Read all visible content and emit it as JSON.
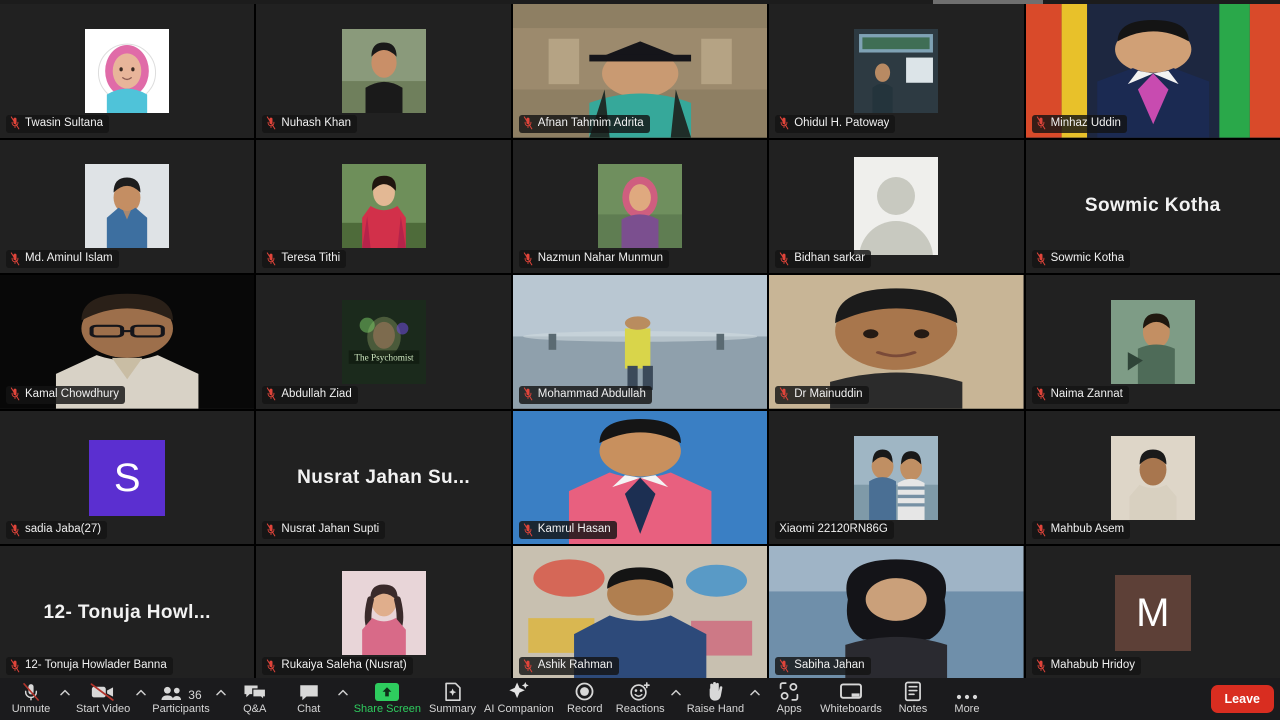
{
  "app": {
    "title": "Zoom Meeting — Gallery View"
  },
  "gallery": {
    "participants": [
      {
        "name": "Twasin Sultana",
        "muted": true,
        "tile_type": "avatar-photo",
        "avatar": {
          "kind": "photo",
          "bg": "#ffffff",
          "skin": "#e8b59a",
          "cloth": "#4fc3d9",
          "accent": "#e06ba8",
          "shape": "hijab"
        }
      },
      {
        "name": "Nuhash Khan",
        "muted": true,
        "tile_type": "avatar-photo",
        "avatar": {
          "kind": "photo",
          "bg": "#8a9a7b",
          "skin": "#c98f68",
          "cloth": "#1a1a1a",
          "accent": "#2b2b2b",
          "shape": "man-outdoor"
        }
      },
      {
        "name": "Afnan Tahmim Adrita",
        "muted": true,
        "tile_type": "video",
        "avatar": {
          "kind": "video",
          "bg": "#8e7f63",
          "skin": "#c99a72",
          "cloth": "#1f2d28",
          "accent": "#36a89a",
          "shape": "graduation"
        }
      },
      {
        "name": "Ohidul H. Patoway",
        "muted": true,
        "tile_type": "avatar-photo",
        "avatar": {
          "kind": "photo",
          "bg": "#2d3a42",
          "skin": "#b88a63",
          "cloth": "#24343c",
          "accent": "#9fb7c4",
          "shape": "indoor-sign"
        }
      },
      {
        "name": "Minhaz Uddin",
        "muted": true,
        "tile_type": "video",
        "avatar": {
          "kind": "video",
          "bg": "#1d2740",
          "skin": "#d0a076",
          "cloth": "#1b2a52",
          "accent": "#c84bb0",
          "shape": "man-suit-stripes"
        }
      },
      {
        "name": "Md. Aminul Islam",
        "muted": true,
        "tile_type": "avatar-photo",
        "avatar": {
          "kind": "photo",
          "bg": "#dfe3e6",
          "skin": "#c48e63",
          "cloth": "#3d6fa0",
          "accent": "#2a2a2a",
          "shape": "man-blue-shirt"
        }
      },
      {
        "name": "Teresa Tithi",
        "muted": true,
        "tile_type": "avatar-photo",
        "avatar": {
          "kind": "photo",
          "bg": "#6e8f5a",
          "skin": "#e3b894",
          "cloth": "#d2304a",
          "accent": "#b5234a",
          "shape": "woman-red"
        }
      },
      {
        "name": "Nazmun Nahar Munmun",
        "muted": true,
        "tile_type": "avatar-photo",
        "avatar": {
          "kind": "photo",
          "bg": "#6f8f5e",
          "skin": "#dfa97f",
          "cloth": "#cf5e7f",
          "accent": "#7b4f8f",
          "shape": "woman-hijab-outdoor"
        }
      },
      {
        "name": "Bidhan sarkar",
        "muted": true,
        "tile_type": "silhouette",
        "avatar": {
          "kind": "silhouette",
          "bg": "#efefec",
          "fg": "#c8c9c0"
        }
      },
      {
        "name": "Sowmic Kotha",
        "muted": true,
        "tile_type": "name-only",
        "display_name": "Sowmic Kotha"
      },
      {
        "name": "Kamal Chowdhury",
        "muted": true,
        "tile_type": "video",
        "avatar": {
          "kind": "video",
          "bg": "#080808",
          "skin": "#9d6f4b",
          "cloth": "#d8d2c6",
          "accent": "#c9bda4",
          "shape": "man-dark-bg"
        }
      },
      {
        "name": "Abdullah Ziad",
        "muted": true,
        "tile_type": "avatar-photo",
        "avatar": {
          "kind": "photo",
          "bg": "#1b2a1c",
          "skin": "#7d6b4e",
          "cloth": "#2a3a20",
          "accent": "#7fd46a",
          "shape": "psychomist-art"
        }
      },
      {
        "name": "Mohammad Abdullah",
        "muted": true,
        "tile_type": "video",
        "avatar": {
          "kind": "video",
          "bg": "#a9b8c4",
          "skin": "#b98c5f",
          "cloth": "#d9d54a",
          "accent": "#3b4a5a",
          "shape": "beach-walk"
        }
      },
      {
        "name": "Dr Mainuddin",
        "muted": true,
        "tile_type": "video",
        "avatar": {
          "kind": "video",
          "bg": "#c8b596",
          "skin": "#a8764c",
          "cloth": "#2b2b2b",
          "accent": "#6d4c2f",
          "shape": "man-portrait"
        }
      },
      {
        "name": "Naima Zannat",
        "muted": true,
        "tile_type": "avatar-photo",
        "avatar": {
          "kind": "photo",
          "bg": "#7e9c86",
          "skin": "#c38f63",
          "cloth": "#4e6b58",
          "accent": "#2f4438",
          "shape": "child-green"
        }
      },
      {
        "name": "sadia Jaba(27)",
        "muted": true,
        "tile_type": "letter",
        "avatar": {
          "kind": "letter",
          "letter": "S",
          "bg": "#5b2fd0",
          "fg": "#ffffff"
        }
      },
      {
        "name": "Nusrat Jahan Supti",
        "muted": true,
        "tile_type": "name-only",
        "display_name": "Nusrat Jahan Su..."
      },
      {
        "name": "Kamrul Hasan",
        "muted": true,
        "tile_type": "video",
        "avatar": {
          "kind": "video",
          "bg": "#3a7fc4",
          "skin": "#c8905e",
          "cloth": "#e8607f",
          "accent": "#1c2f52",
          "shape": "man-pink-shirt"
        }
      },
      {
        "name": "Xiaomi 22120RN86G",
        "muted": false,
        "tile_type": "avatar-photo",
        "avatar": {
          "kind": "photo",
          "bg": "#9fb6c4",
          "skin": "#c08f63",
          "cloth": "#4a6f94",
          "accent": "#e6e6e6",
          "shape": "two-men"
        }
      },
      {
        "name": "Mahbub Asem",
        "muted": true,
        "tile_type": "avatar-photo",
        "avatar": {
          "kind": "photo",
          "bg": "#ded6c8",
          "skin": "#a87murky",
          "cloth": "#d8d0c0",
          "accent": "#7a6a58",
          "shape": "man-beige"
        }
      },
      {
        "name": "12- Tonuja Howlader Banna",
        "muted": true,
        "tile_type": "name-only",
        "display_name": "12- Tonuja Howl..."
      },
      {
        "name": "Rukaiya Saleha (Nusrat)",
        "muted": true,
        "tile_type": "avatar-photo",
        "avatar": {
          "kind": "photo",
          "bg": "#e8d5d8",
          "skin": "#e0ae8c",
          "cloth": "#d86a88",
          "accent": "#3a2a2a",
          "shape": "woman-pink"
        }
      },
      {
        "name": "Ashik Rahman",
        "muted": true,
        "tile_type": "video",
        "avatar": {
          "kind": "video",
          "bg": "#c8c0b0",
          "skin": "#b07f50",
          "cloth": "#2d4a7a",
          "accent": "#d94a3a",
          "shape": "man-mural"
        }
      },
      {
        "name": "Sabiha Jahan",
        "muted": true,
        "tile_type": "video",
        "avatar": {
          "kind": "video",
          "bg": "#6f8faa",
          "skin": "#caa07a",
          "cloth": "#2a2a30",
          "accent": "#1a1a1e",
          "shape": "woman-outdoor"
        }
      },
      {
        "name": "Mahabub Hridoy",
        "muted": true,
        "tile_type": "letter",
        "avatar": {
          "kind": "letter",
          "letter": "M",
          "bg": "#5d4037",
          "fg": "#ffffff"
        }
      }
    ]
  },
  "toolbar": {
    "items": [
      {
        "id": "unmute",
        "label": "Unmute",
        "icon": "mic-muted-icon",
        "caret": true,
        "green": false
      },
      {
        "id": "start-video",
        "label": "Start Video",
        "icon": "video-muted-icon",
        "caret": true,
        "green": false
      },
      {
        "id": "participants",
        "label": "Participants",
        "icon": "participants-icon",
        "caret": true,
        "green": false,
        "badge": "36"
      },
      {
        "id": "qa",
        "label": "Q&A",
        "icon": "qa-icon",
        "caret": false,
        "green": false
      },
      {
        "id": "chat",
        "label": "Chat",
        "icon": "chat-icon",
        "caret": true,
        "green": false
      },
      {
        "id": "share-screen",
        "label": "Share Screen",
        "icon": "share-screen-icon",
        "caret": false,
        "green": true
      },
      {
        "id": "summary",
        "label": "Summary",
        "icon": "summary-icon",
        "caret": false,
        "green": false
      },
      {
        "id": "ai-companion",
        "label": "AI Companion",
        "icon": "ai-sparkle-icon",
        "caret": false,
        "green": false
      },
      {
        "id": "record",
        "label": "Record",
        "icon": "record-icon",
        "caret": false,
        "green": false
      },
      {
        "id": "reactions",
        "label": "Reactions",
        "icon": "reactions-icon",
        "caret": true,
        "green": false
      },
      {
        "id": "raise-hand",
        "label": "Raise Hand",
        "icon": "raise-hand-icon",
        "caret": true,
        "green": false
      },
      {
        "id": "apps",
        "label": "Apps",
        "icon": "apps-icon",
        "caret": false,
        "green": false
      },
      {
        "id": "whiteboards",
        "label": "Whiteboards",
        "icon": "whiteboard-icon",
        "caret": false,
        "green": false
      },
      {
        "id": "notes",
        "label": "Notes",
        "icon": "notes-icon",
        "caret": false,
        "green": false
      },
      {
        "id": "more",
        "label": "More",
        "icon": "more-dots-icon",
        "caret": false,
        "green": false
      }
    ],
    "leave_label": "Leave",
    "participant_count": "36"
  },
  "colors": {
    "toolbar_bg": "#1b1b1d",
    "tile_bg": "#212121",
    "accent_green": "#2ecc5e",
    "leave_red": "#d92d20",
    "mute_red": "#e0443a",
    "text": "#f1f1f1"
  }
}
